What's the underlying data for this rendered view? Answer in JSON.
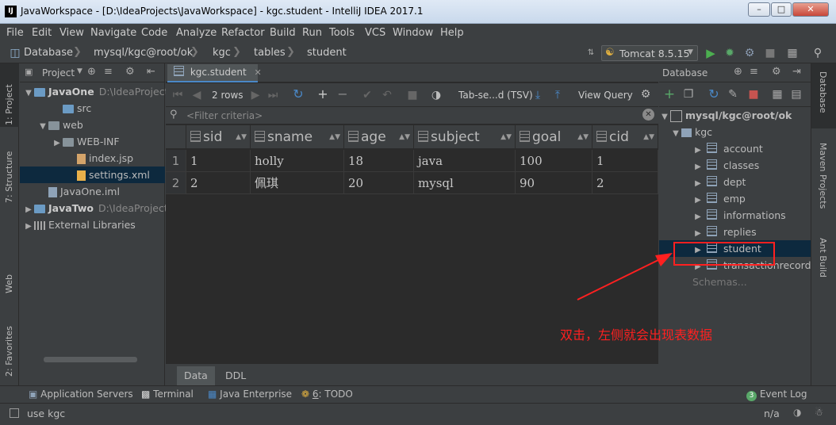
{
  "window": {
    "title": "JavaWorkspace - [D:\\IdeaProjects\\JavaWorkspace] - kgc.student - IntelliJ IDEA 2017.1",
    "app_badge": "IJ"
  },
  "menu": [
    "File",
    "Edit",
    "View",
    "Navigate",
    "Code",
    "Analyze",
    "Refactor",
    "Build",
    "Run",
    "Tools",
    "VCS",
    "Window",
    "Help"
  ],
  "breadcrumb": [
    "Database",
    "mysql/kgc@root/ok",
    "kgc",
    "tables",
    "student"
  ],
  "run_config": "Tomcat 8.5.15",
  "left_tabs": {
    "project": "1: Project",
    "structure": "7: Structure",
    "web": "Web",
    "favorites": "2: Favorites"
  },
  "right_tabs": {
    "database": "Database",
    "maven": "Maven Projects",
    "ant": "Ant Build"
  },
  "project_panel": {
    "header": "Project",
    "tree": [
      {
        "label": "JavaOne",
        "path": "D:\\IdeaProject",
        "indent": 0,
        "arrow": "▼",
        "icon": "folder-blue",
        "bold": true
      },
      {
        "label": "src",
        "indent": 2,
        "arrow": "",
        "icon": "folder-blue"
      },
      {
        "label": "web",
        "indent": 1,
        "arrow": "▼",
        "icon": "folder"
      },
      {
        "label": "WEB-INF",
        "indent": 2,
        "arrow": "▶",
        "icon": "folder"
      },
      {
        "label": "index.jsp",
        "indent": 3,
        "arrow": "",
        "icon": "jsp"
      },
      {
        "label": "settings.xml",
        "indent": 3,
        "arrow": "",
        "icon": "xml",
        "selected": true
      },
      {
        "label": "JavaOne.iml",
        "indent": 1,
        "arrow": "",
        "icon": "iml"
      },
      {
        "label": "JavaTwo",
        "path": "D:\\IdeaProject",
        "indent": 0,
        "arrow": "▶",
        "icon": "folder-blue",
        "bold": true
      },
      {
        "label": "External Libraries",
        "indent": 0,
        "arrow": "▶",
        "icon": "lib"
      }
    ]
  },
  "editor": {
    "tab_label": "kgc.student",
    "rows_label": "2 rows",
    "format_label": "Tab-se...d (TSV)",
    "view_query": "View Query",
    "filter_placeholder": "<Filter criteria>",
    "columns": [
      "sid",
      "sname",
      "age",
      "subject",
      "goal",
      "cid"
    ],
    "rows": [
      [
        "1",
        "1",
        "holly",
        "18",
        "java",
        "100",
        "1"
      ],
      [
        "2",
        "2",
        "佩琪",
        "20",
        "mysql",
        "90",
        "2"
      ]
    ],
    "bottom_tabs": [
      "Data",
      "DDL"
    ]
  },
  "db_panel": {
    "header": "Database",
    "connection": "mysql/kgc@root/ok",
    "schema": "kgc",
    "tables": [
      "account",
      "classes",
      "dept",
      "emp",
      "informations",
      "replies",
      "student",
      "transactionrecord"
    ],
    "selected_table": "student",
    "schemas_link": "Schemas..."
  },
  "annotation": {
    "text": "双击，左侧就会出现表数据",
    "color": "#ff2020"
  },
  "tool_windows": {
    "app_servers": "Application Servers",
    "terminal": "Terminal",
    "java_ee": "Java Enterprise",
    "todo_num": "6",
    "todo": ": TODO",
    "event_log": "Event Log",
    "event_count": "3"
  },
  "status": {
    "message": "use kgc",
    "position": "n/a"
  }
}
